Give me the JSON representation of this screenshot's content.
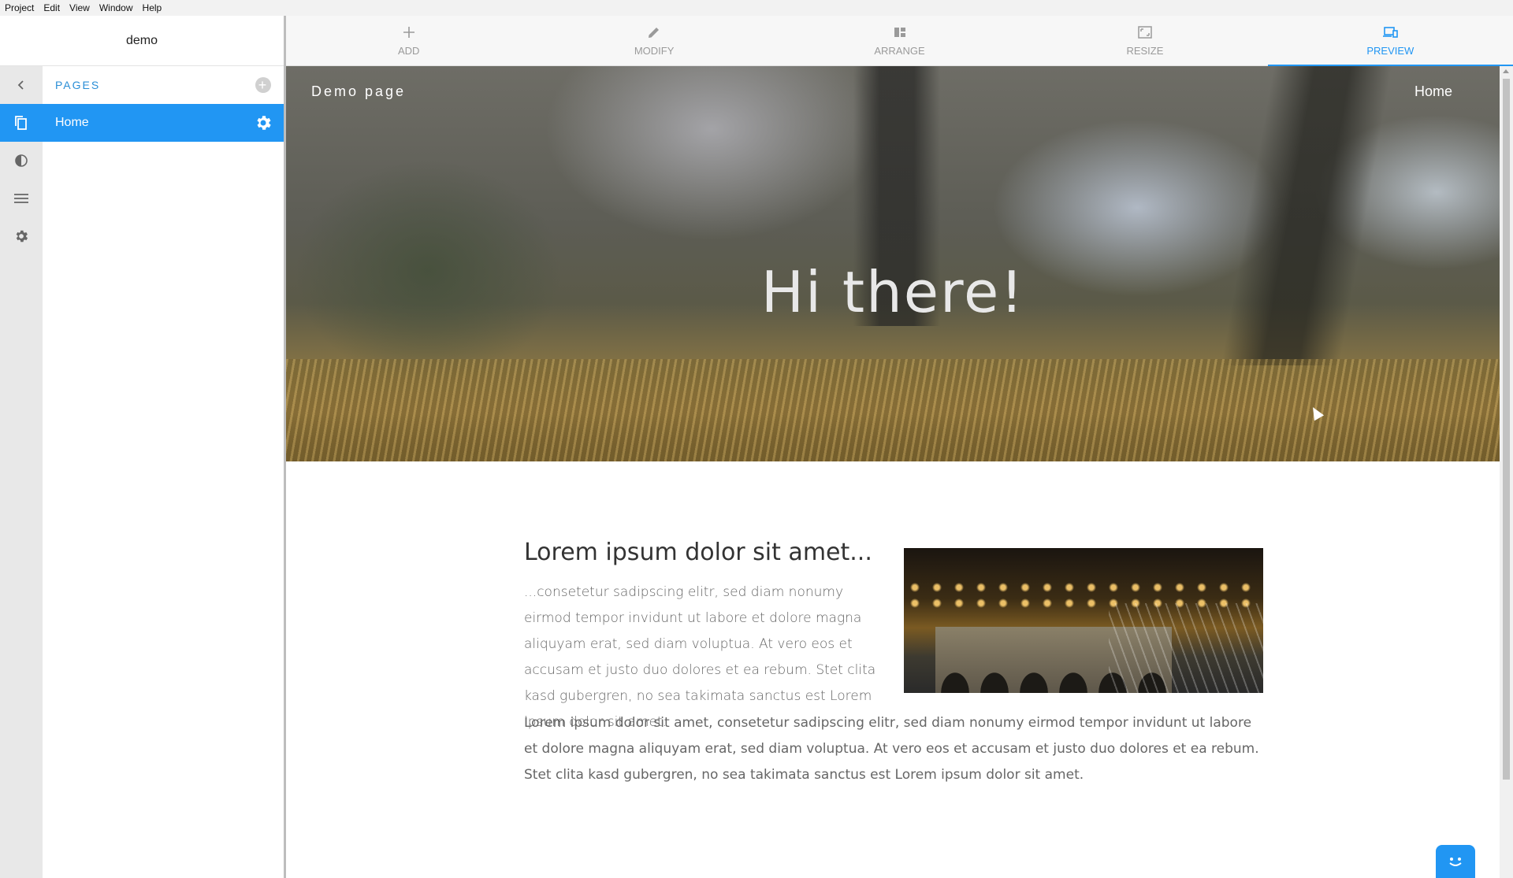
{
  "menu": [
    "Project",
    "Edit",
    "View",
    "Window",
    "Help"
  ],
  "project": {
    "name": "demo"
  },
  "pages_panel": {
    "header": "PAGES",
    "pages": [
      {
        "label": "Home"
      }
    ]
  },
  "toolbar": {
    "tools": [
      {
        "label": "ADD",
        "icon": "plus-icon"
      },
      {
        "label": "MODIFY",
        "icon": "pencil-icon"
      },
      {
        "label": "ARRANGE",
        "icon": "arrange-icon"
      },
      {
        "label": "RESIZE",
        "icon": "resize-icon"
      },
      {
        "label": "PREVIEW",
        "icon": "devices-icon",
        "active": true
      }
    ]
  },
  "preview": {
    "site_title": "Demo page",
    "nav_home": "Home",
    "hero_heading": "Hi there!",
    "article": {
      "title": "Lorem ipsum dolor sit amet...",
      "p1": "...consetetur sadipscing elitr, sed diam nonumy eirmod tempor invidunt ut labore et dolore magna aliquyam erat, sed diam voluptua. At vero eos et accusam et justo duo dolores et ea rebum. Stet clita kasd gubergren, no sea takimata sanctus est Lorem ipsum dolor sit amet.",
      "p2": "Lorem ipsum dolor sit amet, consetetur sadipscing elitr, sed diam nonumy eirmod tempor invidunt ut labore et dolore magna aliquyam erat, sed diam voluptua. At vero eos et accusam et justo duo dolores et ea rebum. Stet clita kasd gubergren, no sea takimata sanctus est Lorem ipsum dolor sit amet."
    }
  },
  "colors": {
    "accent": "#2196f3",
    "rail": "#e8e8e8",
    "toolbar": "#f7f7f7"
  }
}
